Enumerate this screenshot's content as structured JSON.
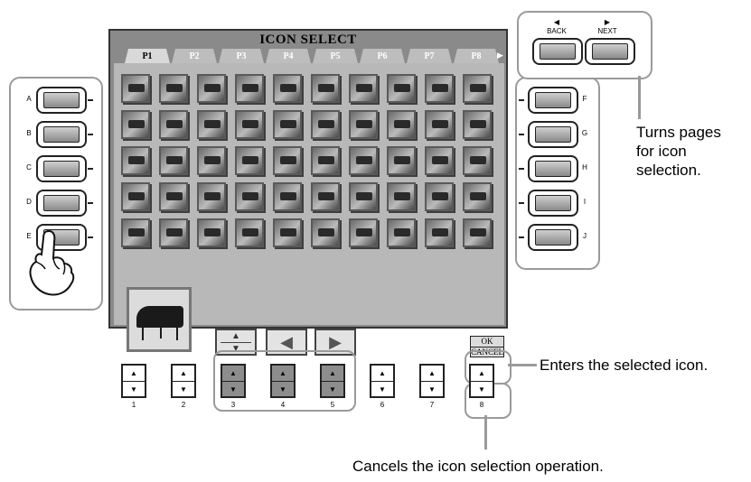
{
  "screen": {
    "title": "ICON SELECT",
    "tabs": [
      "P1",
      "P2",
      "P3",
      "P4",
      "P5",
      "P6",
      "P7",
      "P8"
    ],
    "active_tab": "P1",
    "tab_scroll_arrow": "▶",
    "ok_label": "OK",
    "cancel_label": "CANCEL",
    "up_arrow": "▲",
    "down_arrow": "▼",
    "left_arrow": "◀",
    "right_arrow": "▶"
  },
  "left_buttons": [
    "A",
    "B",
    "C",
    "D",
    "E"
  ],
  "right_buttons": [
    "F",
    "G",
    "H",
    "I",
    "J"
  ],
  "page_buttons": {
    "back_label": "BACK",
    "next_label": "NEXT",
    "back_arrow": "◀",
    "next_arrow": "▶"
  },
  "bottom_buttons": {
    "numbers": [
      "1",
      "2",
      "3",
      "4",
      "5",
      "6",
      "7",
      "8"
    ],
    "up_glyph": "▲",
    "down_glyph": "▼",
    "highlighted": [
      "3",
      "4",
      "5"
    ]
  },
  "captions": {
    "page_turn": [
      "Turns pages",
      "for icon",
      "selection."
    ],
    "enter": "Enters the selected icon.",
    "cancel": "Cancels the icon selection operation."
  },
  "icons": {
    "rows": 5,
    "cols": 10,
    "semantic": "instrument-icon"
  }
}
